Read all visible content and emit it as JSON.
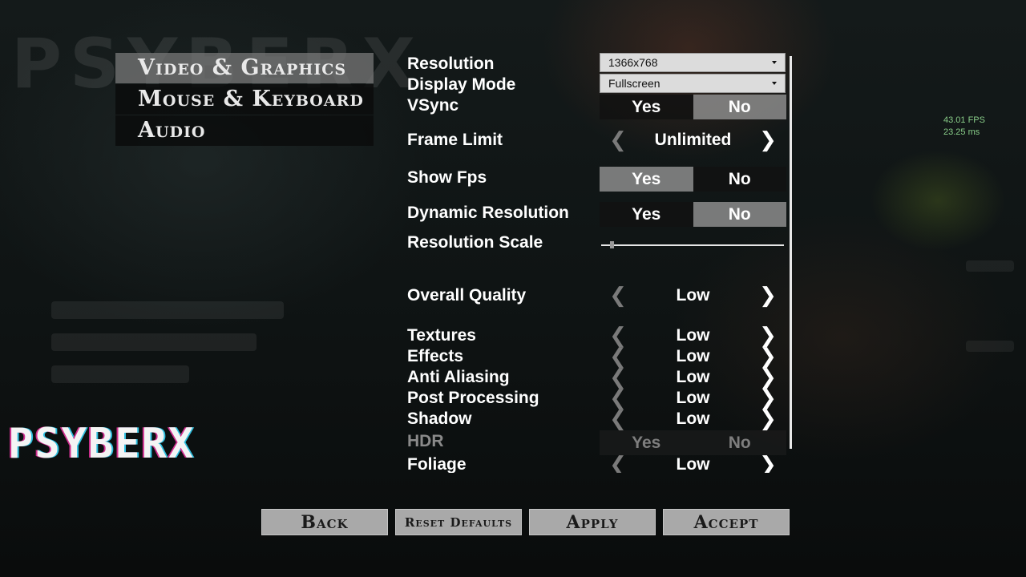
{
  "tabs": [
    {
      "label": "Video & Graphics",
      "active": true
    },
    {
      "label": "Mouse & Keyboard",
      "active": false
    },
    {
      "label": "Audio",
      "active": false
    }
  ],
  "logo": "PSYBERX",
  "fps": {
    "fps_text": "43.01 FPS",
    "ms_text": "23.25 ms"
  },
  "settings": {
    "resolution": {
      "label": "Resolution",
      "value": "1366x768"
    },
    "display_mode": {
      "label": "Display Mode",
      "value": "Fullscreen"
    },
    "vsync": {
      "label": "VSync",
      "yes": "Yes",
      "no": "No",
      "selected": "No"
    },
    "frame_limit": {
      "label": "Frame Limit",
      "value": "Unlimited"
    },
    "show_fps": {
      "label": "Show Fps",
      "yes": "Yes",
      "no": "No",
      "selected": "Yes"
    },
    "dynamic_resolution": {
      "label": "Dynamic Resolution",
      "yes": "Yes",
      "no": "No",
      "selected": "No"
    },
    "resolution_scale": {
      "label": "Resolution Scale",
      "level": 0.05
    },
    "overall_quality": {
      "label": "Overall Quality",
      "value": "Low"
    },
    "textures": {
      "label": "Textures",
      "value": "Low"
    },
    "effects": {
      "label": "Effects",
      "value": "Low"
    },
    "anti_aliasing": {
      "label": "Anti Aliasing",
      "value": "Low"
    },
    "post_processing": {
      "label": "Post Processing",
      "value": "Low"
    },
    "shadow": {
      "label": "Shadow",
      "value": "Low"
    },
    "hdr": {
      "label": "HDR",
      "yes": "Yes",
      "no": "No",
      "disabled": true
    },
    "foliage": {
      "label": "Foliage",
      "value": "Low"
    }
  },
  "arrows": {
    "left": "❮",
    "right": "❯"
  },
  "buttons": {
    "back": "Back",
    "reset": "Reset Defaults",
    "apply": "Apply",
    "accept": "Accept"
  }
}
